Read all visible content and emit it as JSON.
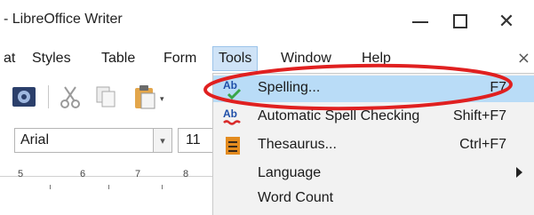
{
  "window": {
    "title": "- LibreOffice Writer",
    "minimize_icon": "minimize-icon",
    "maximize_icon": "maximize-icon",
    "close_glyph": "✕"
  },
  "menubar": {
    "items": [
      {
        "label": "at"
      },
      {
        "label": "Styles"
      },
      {
        "label": "Table"
      },
      {
        "label": "Form"
      },
      {
        "label": "Tools"
      },
      {
        "label": "Window"
      },
      {
        "label": "Help"
      }
    ],
    "more_glyph": "×"
  },
  "toolbar": {
    "icons": [
      "navigator-icon",
      "cut-icon",
      "copy-icon",
      "paste-icon"
    ]
  },
  "formatting": {
    "font_name": "Arial",
    "font_size": "11",
    "dropdown_glyph": "▾"
  },
  "ruler": {
    "numbers": [
      "5",
      "6",
      "7",
      "8"
    ]
  },
  "tools_menu": {
    "items": [
      {
        "label": "Spelling...",
        "shortcut": "F7",
        "icon": "spelling-icon",
        "highlighted": true
      },
      {
        "label": "Automatic Spell Checking",
        "shortcut": "Shift+F7",
        "icon": "auto-spellcheck-icon"
      },
      {
        "label": "Thesaurus...",
        "shortcut": "Ctrl+F7",
        "icon": "thesaurus-icon"
      },
      {
        "label": "Language",
        "shortcut": "",
        "icon": "",
        "submenu": true
      },
      {
        "label": "Word Count",
        "shortcut": "",
        "icon": ""
      }
    ]
  },
  "colors": {
    "menu_highlight": "#b9dcf7",
    "annotation_red": "#e02020"
  }
}
